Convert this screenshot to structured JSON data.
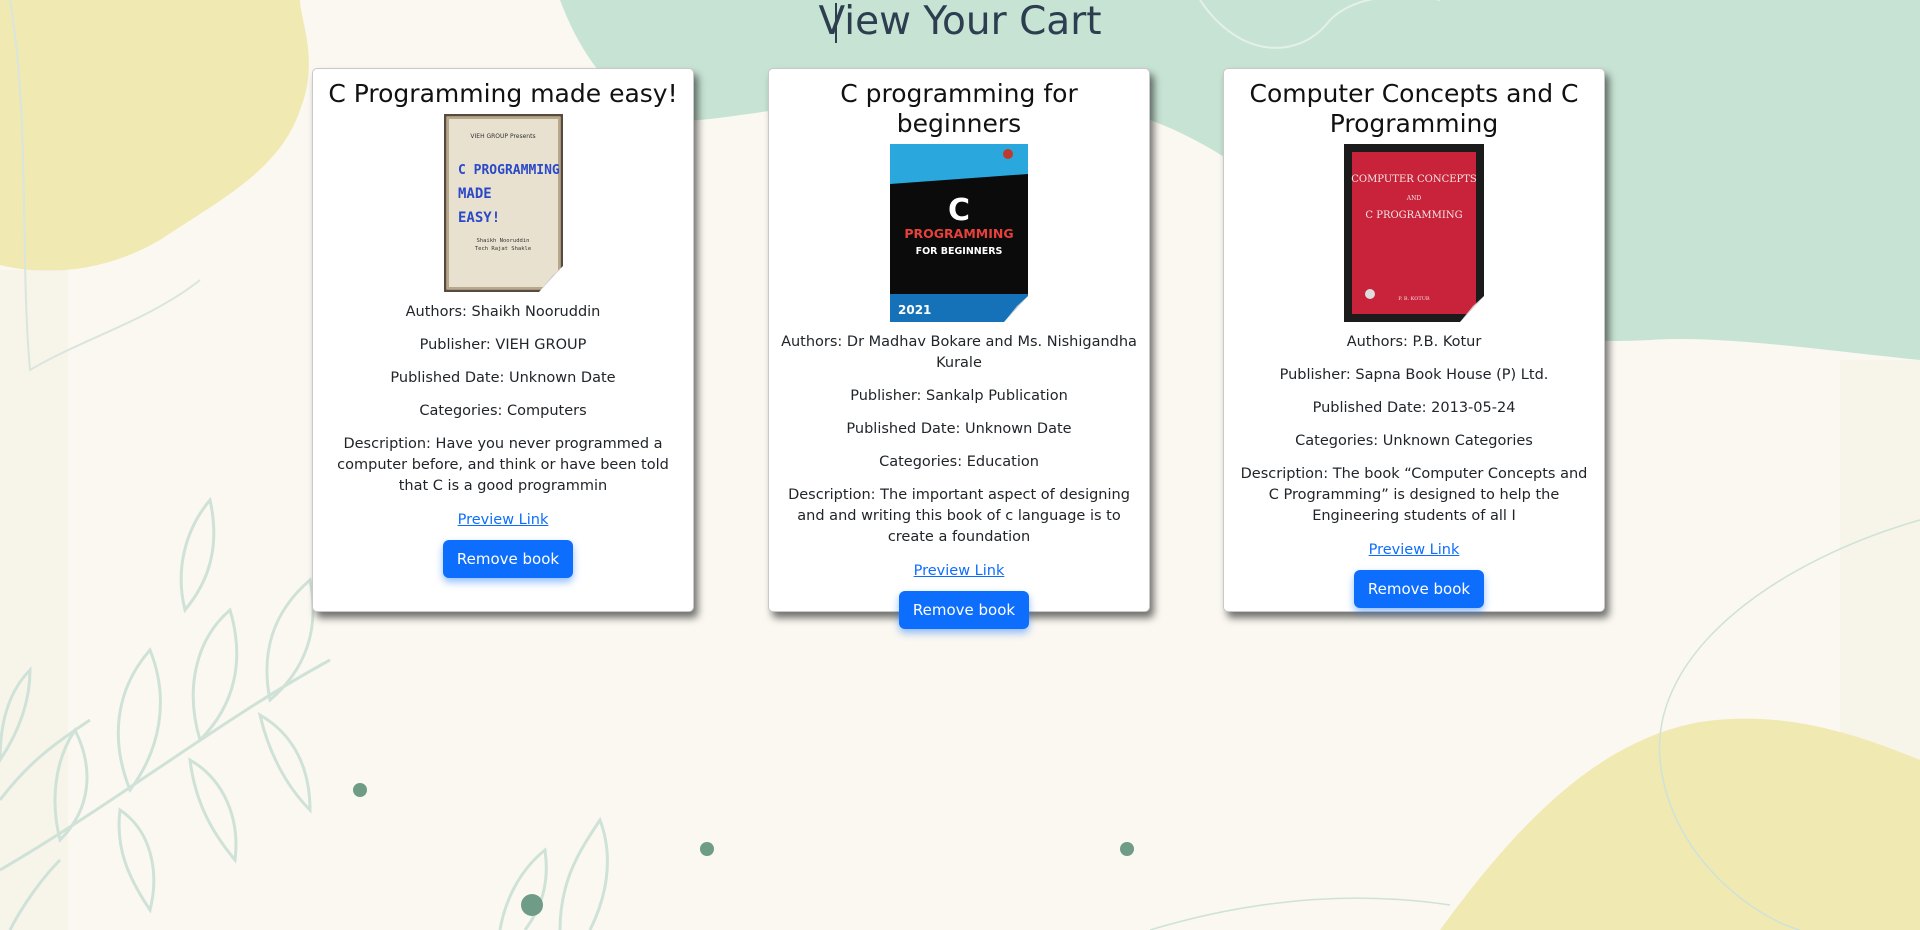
{
  "page": {
    "title": "View Your Cart"
  },
  "books": [
    {
      "title": "C Programming made easy!",
      "cover_lines": [
        "VIEH GROUP Presents",
        "C PROGRAMMING",
        "MADE",
        "EASY!",
        "Shaikh Nooruddin",
        "Tech Rajat Shakle"
      ],
      "authors": "Authors: Shaikh Nooruddin",
      "publisher": "Publisher: VIEH GROUP",
      "published": "Published Date: Unknown Date",
      "categories": "Categories: Computers",
      "description": "Description: Have you never programmed a computer before, and think or have been told that C is a good programmin",
      "preview_label": "Preview Link",
      "remove_label": "Remove book"
    },
    {
      "title": "C programming for beginners",
      "cover_lines": [
        "C",
        "PROGRAMMING",
        "FOR BEGINNERS",
        "2021"
      ],
      "authors": "Authors: Dr Madhav Bokare and Ms. Nishigandha Kurale",
      "publisher": "Publisher: Sankalp Publication",
      "published": "Published Date: Unknown Date",
      "categories": "Categories: Education",
      "description": "Description: The important aspect of designing and and writing this book of c language is to create a foundation",
      "preview_label": "Preview Link",
      "remove_label": "Remove book"
    },
    {
      "title": "Computer Concepts and C Programming",
      "cover_lines": [
        "COMPUTER CONCEPTS",
        "AND",
        "C PROGRAMMING",
        "P. B. KOTUR"
      ],
      "authors": "Authors: P.B. Kotur",
      "publisher": "Publisher: Sapna Book House (P) Ltd.",
      "published": "Published Date: 2013-05-24",
      "categories": "Categories: Unknown Categories",
      "description": "Description: The book “Computer Concepts and C Programming” is designed to help the Engineering students of all I",
      "preview_label": "Preview Link",
      "remove_label": "Remove book"
    }
  ],
  "colors": {
    "accent": "#0d6efd",
    "mint": "#c7e3d4",
    "cream": "#f1e9b2",
    "page_bg": "#fbf8f1"
  }
}
